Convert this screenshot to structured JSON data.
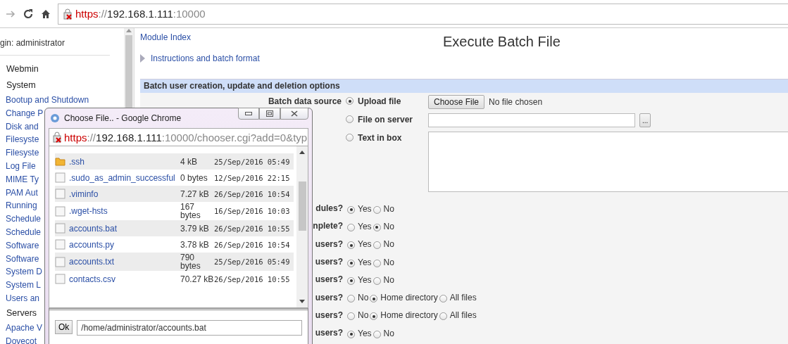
{
  "browser": {
    "url": [
      {
        "kind": "scheme",
        "text": "https"
      },
      {
        "kind": "dim",
        "text": "://"
      },
      {
        "kind": "host",
        "text": "192.168.1.111"
      },
      {
        "kind": "dim",
        "text": ":10000"
      }
    ]
  },
  "sidebar": {
    "login": "gin: administrator",
    "sections": [
      {
        "title": "Webmin"
      },
      {
        "title": "System",
        "items": [
          "Bootup and Shutdown",
          "Change P",
          "Disk and",
          "Filesyste",
          "Filesyste",
          "Log File",
          "MIME Ty",
          "PAM Aut",
          "Running",
          "Schedule",
          "Schedule",
          "Software",
          "Software",
          "System D",
          "System L",
          "Users an"
        ]
      },
      {
        "title": "Servers",
        "items": [
          "Apache V",
          "Dovecot"
        ]
      }
    ]
  },
  "main": {
    "module_index": "Module Index",
    "title": "Execute Batch File",
    "instructions": "Instructions and batch format",
    "section_title": "Batch user creation, update and deletion options",
    "source": {
      "label": "Batch data source",
      "choose_button": "Choose File",
      "no_file": "No file chosen",
      "browse_button": "...",
      "options": [
        {
          "kind": "upload",
          "label": "Upload file",
          "selected": true
        },
        {
          "kind": "server",
          "label": "File on server",
          "selected": false
        },
        {
          "kind": "text",
          "label": "Text in box",
          "selected": false
        }
      ]
    },
    "questions": [
      {
        "label": "dules?",
        "options": [
          {
            "label": "Yes",
            "selected": true
          },
          {
            "label": "No",
            "selected": false
          }
        ]
      },
      {
        "label": "nplete?",
        "options": [
          {
            "label": "Yes",
            "selected": false
          },
          {
            "label": "No",
            "selected": true
          }
        ]
      },
      {
        "label": "users?",
        "options": [
          {
            "label": "Yes",
            "selected": true
          },
          {
            "label": "No",
            "selected": false
          }
        ]
      },
      {
        "label": "users?",
        "options": [
          {
            "label": "Yes",
            "selected": true
          },
          {
            "label": "No",
            "selected": false
          }
        ]
      },
      {
        "label": "users?",
        "options": [
          {
            "label": "Yes",
            "selected": true
          },
          {
            "label": "No",
            "selected": false
          }
        ]
      },
      {
        "label": "users?",
        "options": [
          {
            "label": "No",
            "selected": false
          },
          {
            "label": "Home directory",
            "selected": true
          },
          {
            "label": "All files",
            "selected": false
          }
        ]
      },
      {
        "label": "users?",
        "options": [
          {
            "label": "No",
            "selected": false
          },
          {
            "label": "Home directory",
            "selected": true
          },
          {
            "label": "All files",
            "selected": false
          }
        ]
      },
      {
        "label": "users?",
        "options": [
          {
            "label": "Yes",
            "selected": true
          },
          {
            "label": "No",
            "selected": false
          }
        ]
      }
    ]
  },
  "dialog": {
    "title": "Choose File.. - Google Chrome",
    "url": [
      {
        "kind": "scheme",
        "text": "https"
      },
      {
        "kind": "dim",
        "text": "://"
      },
      {
        "kind": "host",
        "text": "192.168.1.111"
      },
      {
        "kind": "dim",
        "text": ":10000/chooser.cgi?add=0&typ"
      }
    ],
    "files": [
      {
        "kind": "folder",
        "name": ".ssh",
        "size": "4 kB",
        "modified": "25/Sep/2016 05:49"
      },
      {
        "kind": "file",
        "name": ".sudo_as_admin_successful",
        "size": "0 bytes",
        "modified": "12/Sep/2016 22:15"
      },
      {
        "kind": "file",
        "name": ".viminfo",
        "size": "7.27 kB",
        "modified": "26/Sep/2016 10:54"
      },
      {
        "kind": "file",
        "name": ".wget-hsts",
        "size": "167 bytes",
        "modified": "16/Sep/2016 10:03"
      },
      {
        "kind": "file",
        "name": "accounts.bat",
        "size": "3.79 kB",
        "modified": "26/Sep/2016 10:55"
      },
      {
        "kind": "file",
        "name": "accounts.py",
        "size": "3.78 kB",
        "modified": "26/Sep/2016 10:54"
      },
      {
        "kind": "file",
        "name": "accounts.txt",
        "size": "790 bytes",
        "modified": "25/Sep/2016 05:49"
      },
      {
        "kind": "file",
        "name": "contacts.csv",
        "size": "70.27 kB",
        "modified": "26/Sep/2016 10:55"
      }
    ],
    "ok_button": "Ok",
    "path": "/home/administrator/accounts.bat"
  }
}
